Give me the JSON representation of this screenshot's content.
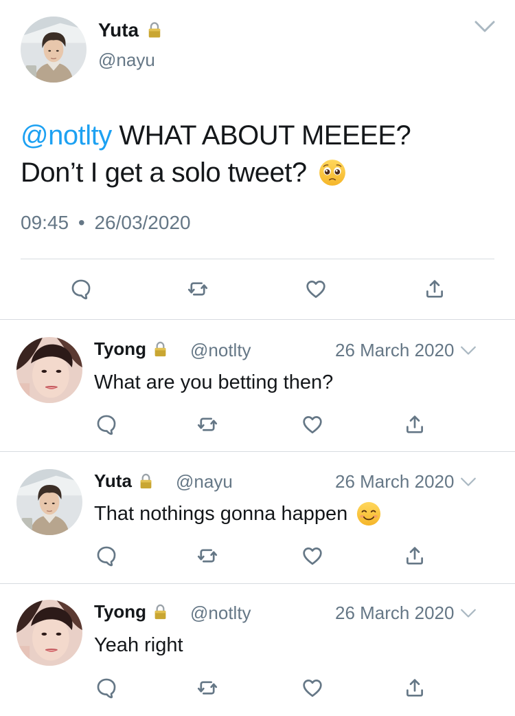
{
  "main_tweet": {
    "author_name": "Yuta",
    "author_handle": "@nayu",
    "mention": "@notlty",
    "text_line1": " WHAT ABOUT MEEEE?",
    "text_line2": "Don’t I get a solo tweet?",
    "emoji": "pleading-face",
    "time": "09:45",
    "separator": "•",
    "date": "26/03/2020"
  },
  "replies": [
    {
      "author_name": "Tyong",
      "author_handle": "@notlty",
      "date": "26 March 2020",
      "text": "What are you betting then?",
      "emoji": ""
    },
    {
      "author_name": "Yuta",
      "author_handle": "@nayu",
      "date": "26 March 2020",
      "text": "That nothings gonna happen",
      "emoji": "smiling-face"
    },
    {
      "author_name": "Tyong",
      "author_handle": "@notlty",
      "date": "26 March 2020",
      "text": "Yeah right",
      "emoji": ""
    }
  ],
  "icons": {
    "reply": "reply-icon",
    "retweet": "retweet-icon",
    "like": "heart-icon",
    "share": "share-icon",
    "protected": "lock-icon",
    "menu": "chevron-down-icon"
  },
  "colors": {
    "accent": "#1da1f2",
    "secondary_text": "#657786",
    "icon": "#657786",
    "divider": "#d7dbe0"
  }
}
